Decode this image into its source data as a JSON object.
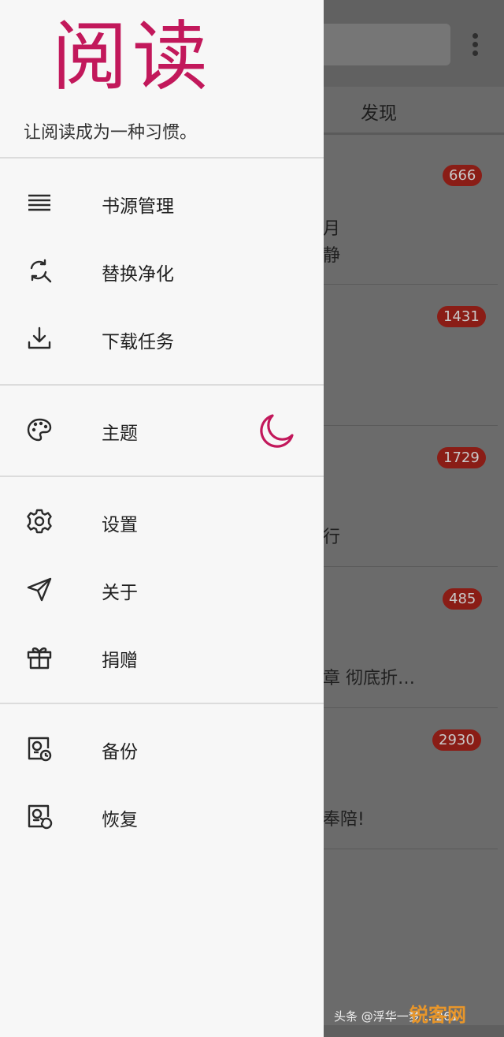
{
  "drawer": {
    "app_title": "阅读",
    "slogan": "让阅读成为一种习惯。",
    "accent_color": "#c2185b",
    "groups": [
      {
        "items": [
          {
            "label": "书源管理",
            "icon": "list-icon"
          },
          {
            "label": "替换净化",
            "icon": "find-replace-icon"
          },
          {
            "label": "下载任务",
            "icon": "download-icon"
          }
        ]
      },
      {
        "items": [
          {
            "label": "主题",
            "icon": "palette-icon"
          }
        ]
      },
      {
        "items": [
          {
            "label": "设置",
            "icon": "gear-icon"
          },
          {
            "label": "关于",
            "icon": "send-icon"
          },
          {
            "label": "捐赠",
            "icon": "gift-icon"
          }
        ]
      },
      {
        "items": [
          {
            "label": "备份",
            "icon": "backup-icon"
          },
          {
            "label": "恢复",
            "icon": "restore-icon"
          }
        ]
      }
    ],
    "theme_toggle_icon": "moon-icon"
  },
  "background": {
    "tab_label": "发现",
    "rows": [
      {
        "badge": "666",
        "line1": "月",
        "line2": "静"
      },
      {
        "badge": "1431",
        "line1": "",
        "line2": ""
      },
      {
        "badge": "1729",
        "line1": "",
        "line2": "行"
      },
      {
        "badge": "485",
        "line1": "",
        "line2": "章 彻底折…"
      },
      {
        "badge": "2930",
        "line1": "",
        "line2": "奉陪!"
      }
    ],
    "badge_color": "#8a1d16"
  },
  "watermark": {
    "text": "头条 @浮华一梦 …261",
    "logo": "锐客网"
  }
}
